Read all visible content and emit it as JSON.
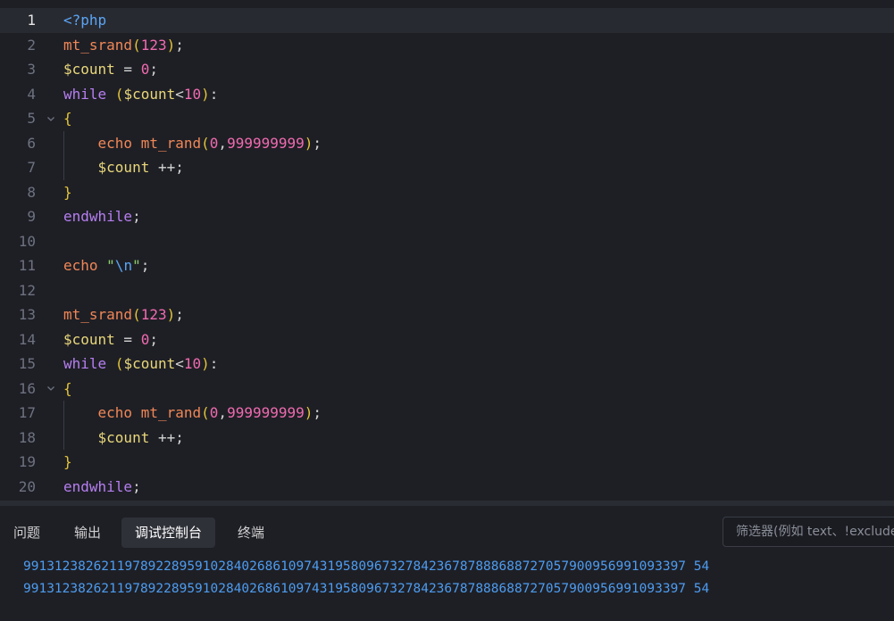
{
  "editor": {
    "current_line": 1,
    "lines": [
      {
        "n": "1",
        "tokens": [
          [
            "t-tag",
            "<?php"
          ]
        ]
      },
      {
        "n": "2",
        "tokens": [
          [
            "t-fn",
            "mt_srand"
          ],
          [
            "t-paren",
            "("
          ],
          [
            "t-num",
            "123"
          ],
          [
            "t-paren",
            ")"
          ],
          [
            "t-op",
            ";"
          ]
        ]
      },
      {
        "n": "3",
        "tokens": [
          [
            "t-var",
            "$count"
          ],
          [
            "t-op",
            " = "
          ],
          [
            "t-num",
            "0"
          ],
          [
            "t-op",
            ";"
          ]
        ]
      },
      {
        "n": "4",
        "tokens": [
          [
            "t-kw",
            "while"
          ],
          [
            "t-op",
            " "
          ],
          [
            "t-paren",
            "("
          ],
          [
            "t-var",
            "$count"
          ],
          [
            "t-op",
            "<"
          ],
          [
            "t-num",
            "10"
          ],
          [
            "t-paren",
            ")"
          ],
          [
            "t-op",
            ":"
          ]
        ]
      },
      {
        "n": "5",
        "fold": true,
        "tokens": [
          [
            "t-paren",
            "{"
          ]
        ]
      },
      {
        "n": "6",
        "tokens": [
          [
            "t-op",
            "    "
          ],
          [
            "t-fn",
            "echo"
          ],
          [
            "t-op",
            " "
          ],
          [
            "t-fn",
            "mt_rand"
          ],
          [
            "t-paren",
            "("
          ],
          [
            "t-num",
            "0"
          ],
          [
            "t-op",
            ","
          ],
          [
            "t-num",
            "999999999"
          ],
          [
            "t-paren",
            ")"
          ],
          [
            "t-op",
            ";"
          ]
        ]
      },
      {
        "n": "7",
        "tokens": [
          [
            "t-op",
            "    "
          ],
          [
            "t-var",
            "$count"
          ],
          [
            "t-op",
            " ++;"
          ]
        ]
      },
      {
        "n": "8",
        "tokens": [
          [
            "t-paren",
            "}"
          ]
        ]
      },
      {
        "n": "9",
        "tokens": [
          [
            "t-kw",
            "endwhile"
          ],
          [
            "t-op",
            ";"
          ]
        ]
      },
      {
        "n": "10",
        "tokens": []
      },
      {
        "n": "11",
        "tokens": [
          [
            "t-fn",
            "echo"
          ],
          [
            "t-op",
            " "
          ],
          [
            "t-str",
            "\""
          ],
          [
            "t-esc",
            "\\n"
          ],
          [
            "t-str",
            "\""
          ],
          [
            "t-op",
            ";"
          ]
        ]
      },
      {
        "n": "12",
        "tokens": []
      },
      {
        "n": "13",
        "tokens": [
          [
            "t-fn",
            "mt_srand"
          ],
          [
            "t-paren",
            "("
          ],
          [
            "t-num",
            "123"
          ],
          [
            "t-paren",
            ")"
          ],
          [
            "t-op",
            ";"
          ]
        ]
      },
      {
        "n": "14",
        "tokens": [
          [
            "t-var",
            "$count"
          ],
          [
            "t-op",
            " = "
          ],
          [
            "t-num",
            "0"
          ],
          [
            "t-op",
            ";"
          ]
        ]
      },
      {
        "n": "15",
        "tokens": [
          [
            "t-kw",
            "while"
          ],
          [
            "t-op",
            " "
          ],
          [
            "t-paren",
            "("
          ],
          [
            "t-var",
            "$count"
          ],
          [
            "t-op",
            "<"
          ],
          [
            "t-num",
            "10"
          ],
          [
            "t-paren",
            ")"
          ],
          [
            "t-op",
            ":"
          ]
        ]
      },
      {
        "n": "16",
        "fold": true,
        "tokens": [
          [
            "t-paren",
            "{"
          ]
        ]
      },
      {
        "n": "17",
        "tokens": [
          [
            "t-op",
            "    "
          ],
          [
            "t-fn",
            "echo"
          ],
          [
            "t-op",
            " "
          ],
          [
            "t-fn",
            "mt_rand"
          ],
          [
            "t-paren",
            "("
          ],
          [
            "t-num",
            "0"
          ],
          [
            "t-op",
            ","
          ],
          [
            "t-num",
            "999999999"
          ],
          [
            "t-paren",
            ")"
          ],
          [
            "t-op",
            ";"
          ]
        ]
      },
      {
        "n": "18",
        "tokens": [
          [
            "t-op",
            "    "
          ],
          [
            "t-var",
            "$count"
          ],
          [
            "t-op",
            " ++;"
          ]
        ]
      },
      {
        "n": "19",
        "tokens": [
          [
            "t-paren",
            "}"
          ]
        ]
      },
      {
        "n": "20",
        "tokens": [
          [
            "t-kw",
            "endwhile"
          ],
          [
            "t-op",
            ";"
          ]
        ]
      }
    ],
    "fold_icon": "chevron-down-icon"
  },
  "panel": {
    "tabs": [
      {
        "label": "问题",
        "active": false
      },
      {
        "label": "输出",
        "active": false
      },
      {
        "label": "调试控制台",
        "active": true
      },
      {
        "label": "终端",
        "active": false
      }
    ],
    "filter_placeholder": "筛选器(例如 text、!exclude)",
    "output_lines": [
      "9913123826211978922895910284026861097431958096732784236787888688727057900956991093397 54",
      "9913123826211978922895910284026861097431958096732784236787888688727057900956991093397 54"
    ]
  },
  "colors": {
    "background": "#1e1f25",
    "current_line": "#282a31",
    "output_text": "#4d9cf0"
  }
}
